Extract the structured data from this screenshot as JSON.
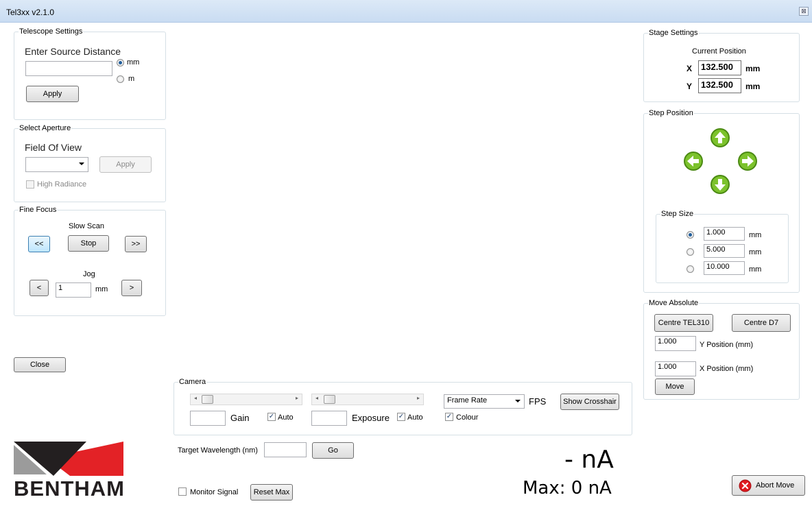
{
  "window": {
    "title": "Tel3xx v2.1.0",
    "close_glyph": "⊠"
  },
  "telescope": {
    "legend": "Telescope Settings",
    "prompt": "Enter Source Distance",
    "distance_value": "",
    "unit_mm": "mm",
    "unit_m": "m",
    "selected_unit": "mm",
    "apply_label": "Apply"
  },
  "aperture": {
    "legend": "Select Aperture",
    "prompt": "Field Of View",
    "fov_value": "",
    "apply_label": "Apply",
    "high_radiance_label": "High Radiance"
  },
  "fine_focus": {
    "legend": "Fine Focus",
    "slow_scan_label": "Slow Scan",
    "scan_back_label": "<<",
    "stop_label": "Stop",
    "scan_forward_label": ">>",
    "jog_label": "Jog",
    "jog_back_label": "<",
    "jog_value": "1",
    "jog_unit": "mm",
    "jog_forward_label": ">"
  },
  "close_label": "Close",
  "camera": {
    "legend": "Camera",
    "gain_value": "",
    "gain_label": "Gain",
    "gain_auto_label": "Auto",
    "exposure_value": "",
    "exposure_label": "Exposure",
    "exposure_auto_label": "Auto",
    "frame_rate_value": "Frame Rate",
    "fps_label": "FPS",
    "crosshair_label": "Show Crosshair",
    "colour_label": "Colour",
    "gain_auto_checked": true,
    "exposure_auto_checked": true,
    "colour_checked": true
  },
  "wavelength": {
    "label": "Target Wavelength (nm)",
    "value": "",
    "go_label": "Go"
  },
  "monitor": {
    "label": "Monitor Signal",
    "checked": false,
    "reset_label": "Reset Max"
  },
  "signal": {
    "current": "- nA",
    "max": "Max: 0 nA"
  },
  "logo": {
    "text": "BENTHAM"
  },
  "stage": {
    "legend": "Stage Settings",
    "current_position_label": "Current Position",
    "x_label": "X",
    "x_value": "132.500",
    "y_label": "Y",
    "y_value": "132.500",
    "unit": "mm"
  },
  "step_position": {
    "legend": "Step Position",
    "step_size_legend": "Step Size",
    "sizes": [
      {
        "value": "1.000",
        "unit": "mm",
        "selected": true
      },
      {
        "value": "5.000",
        "unit": "mm",
        "selected": false
      },
      {
        "value": "10.000",
        "unit": "mm",
        "selected": false
      }
    ],
    "arrow_color": "#7cc22c"
  },
  "move_absolute": {
    "legend": "Move Absolute",
    "centre_tel310_label": "Centre TEL310",
    "centre_d7_label": "Centre D7",
    "y_value": "1.000",
    "y_label": "Y Position (mm)",
    "x_value": "1.000",
    "x_label": "X Position (mm)",
    "move_label": "Move"
  },
  "abort_label": "Abort Move"
}
